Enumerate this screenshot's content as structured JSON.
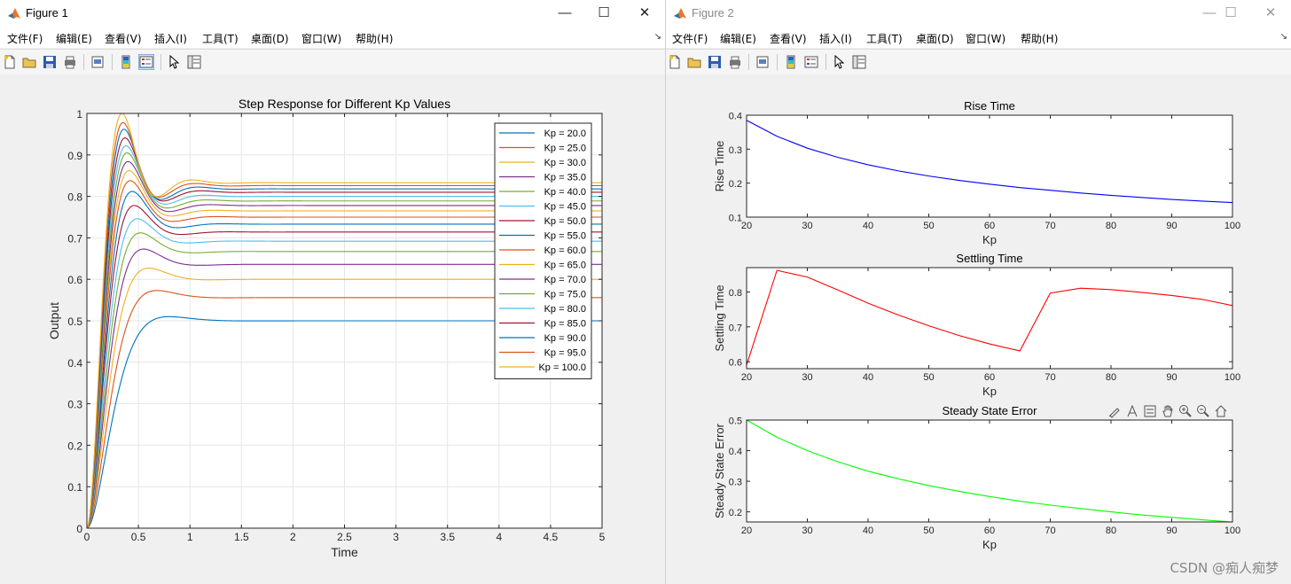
{
  "windows": [
    {
      "title": "Figure 1",
      "menus": [
        "文件(F)",
        "编辑(E)",
        "查看(V)",
        "插入(I)",
        "工具(T)",
        "桌面(D)",
        "窗口(W)",
        "帮助(H)"
      ]
    },
    {
      "title": "Figure 2",
      "menus": [
        "文件(F)",
        "编辑(E)",
        "查看(V)",
        "插入(I)",
        "工具(T)",
        "桌面(D)",
        "窗口(W)",
        "帮助(H)"
      ]
    }
  ],
  "window_controls": {
    "minimize": "—",
    "maximize": "☐",
    "close": "✕"
  },
  "toolbar_icons": [
    "new-figure-icon",
    "open-file-icon",
    "save-icon",
    "print-icon",
    "print-preview-icon",
    "colorbar-icon",
    "legend-icon",
    "pointer-icon",
    "property-editor-icon"
  ],
  "axes_toolbar_icons": [
    "brush-icon",
    "data-tips-icon",
    "export-icon",
    "pan-icon",
    "zoom-in-icon",
    "zoom-out-icon",
    "home-icon"
  ],
  "watermark": "CSDN @痴人痴梦",
  "chart_data": [
    {
      "type": "line",
      "title": "Step Response for Different Kp Values",
      "xlabel": "Time",
      "ylabel": "Output",
      "xlim": [
        0,
        5
      ],
      "ylim": [
        0,
        1
      ],
      "xticks": [
        "0",
        "0.5",
        "1",
        "1.5",
        "2",
        "2.5",
        "3",
        "3.5",
        "4",
        "4.5",
        "5"
      ],
      "yticks": [
        "0",
        "0.1",
        "0.2",
        "0.3",
        "0.4",
        "0.5",
        "0.6",
        "0.7",
        "0.8",
        "0.9",
        "1"
      ],
      "grid": true,
      "legend_position": "top-right",
      "series": [
        {
          "name": "Kp = 20.0",
          "color": "#0072BD",
          "final": 0.5,
          "peak": 0.51,
          "peak_time": 0.8
        },
        {
          "name": "Kp = 25.0",
          "color": "#D95319",
          "final": 0.556,
          "peak": 0.573,
          "peak_time": 0.68
        },
        {
          "name": "Kp = 30.0",
          "color": "#EDB120",
          "final": 0.6,
          "peak": 0.627,
          "peak_time": 0.6
        },
        {
          "name": "Kp = 35.0",
          "color": "#7E2F8E",
          "final": 0.636,
          "peak": 0.673,
          "peak_time": 0.55
        },
        {
          "name": "Kp = 40.0",
          "color": "#77AC30",
          "final": 0.667,
          "peak": 0.712,
          "peak_time": 0.52
        },
        {
          "name": "Kp = 45.0",
          "color": "#4DBEEE",
          "final": 0.692,
          "peak": 0.746,
          "peak_time": 0.49
        },
        {
          "name": "Kp = 50.0",
          "color": "#A2142F",
          "final": 0.714,
          "peak": 0.778,
          "peak_time": 0.46
        },
        {
          "name": "Kp = 55.0",
          "color": "#0072BD",
          "final": 0.733,
          "peak": 0.812,
          "peak_time": 0.44
        },
        {
          "name": "Kp = 60.0",
          "color": "#D95319",
          "final": 0.75,
          "peak": 0.838,
          "peak_time": 0.42
        },
        {
          "name": "Kp = 65.0",
          "color": "#EDB120",
          "final": 0.765,
          "peak": 0.862,
          "peak_time": 0.41
        },
        {
          "name": "Kp = 70.0",
          "color": "#7E2F8E",
          "final": 0.778,
          "peak": 0.884,
          "peak_time": 0.4
        },
        {
          "name": "Kp = 75.0",
          "color": "#77AC30",
          "final": 0.789,
          "peak": 0.905,
          "peak_time": 0.39
        },
        {
          "name": "Kp = 80.0",
          "color": "#4DBEEE",
          "final": 0.8,
          "peak": 0.922,
          "peak_time": 0.38
        },
        {
          "name": "Kp = 85.0",
          "color": "#A2142F",
          "final": 0.81,
          "peak": 0.941,
          "peak_time": 0.37
        },
        {
          "name": "Kp = 90.0",
          "color": "#0072BD",
          "final": 0.818,
          "peak": 0.962,
          "peak_time": 0.36
        },
        {
          "name": "Kp = 95.0",
          "color": "#D95319",
          "final": 0.826,
          "peak": 0.978,
          "peak_time": 0.35
        },
        {
          "name": "Kp = 100.0",
          "color": "#EDB120",
          "final": 0.833,
          "peak": 1.0,
          "peak_time": 0.34
        }
      ]
    },
    {
      "type": "line",
      "title": "Rise Time",
      "xlabel": "Kp",
      "ylabel": "Rise Time",
      "xlim": [
        20,
        100
      ],
      "ylim": [
        0.1,
        0.4
      ],
      "xticks": [
        "20",
        "30",
        "40",
        "50",
        "60",
        "70",
        "80",
        "90",
        "100"
      ],
      "yticks": [
        "0.1",
        "0.2",
        "0.3",
        "0.4"
      ],
      "color": "#0000FF",
      "x": [
        20,
        25,
        30,
        35,
        40,
        45,
        50,
        55,
        60,
        65,
        70,
        75,
        80,
        85,
        90,
        95,
        100
      ],
      "y": [
        0.385,
        0.338,
        0.303,
        0.276,
        0.254,
        0.236,
        0.221,
        0.208,
        0.197,
        0.187,
        0.179,
        0.171,
        0.164,
        0.158,
        0.152,
        0.147,
        0.143
      ]
    },
    {
      "type": "line",
      "title": "Settling Time",
      "xlabel": "Kp",
      "ylabel": "Settling Time",
      "xlim": [
        20,
        100
      ],
      "ylim": [
        0.58,
        0.87
      ],
      "xticks": [
        "20",
        "30",
        "40",
        "50",
        "60",
        "70",
        "80",
        "90",
        "100"
      ],
      "yticks": [
        "0.6",
        "0.7",
        "0.8"
      ],
      "color": "#FF0000",
      "x": [
        20,
        25,
        30,
        35,
        40,
        45,
        50,
        55,
        60,
        65,
        70,
        75,
        80,
        85,
        90,
        95,
        100
      ],
      "y": [
        0.59,
        0.862,
        0.843,
        0.806,
        0.768,
        0.734,
        0.703,
        0.675,
        0.651,
        0.631,
        0.797,
        0.811,
        0.807,
        0.799,
        0.79,
        0.779,
        0.761
      ]
    },
    {
      "type": "line",
      "title": "Steady State Error",
      "xlabel": "Kp",
      "ylabel": "Steady State Error",
      "xlim": [
        20,
        100
      ],
      "ylim": [
        0.167,
        0.5
      ],
      "xticks": [
        "20",
        "30",
        "40",
        "50",
        "60",
        "70",
        "80",
        "90",
        "100"
      ],
      "yticks": [
        "0.2",
        "0.3",
        "0.4",
        "0.5"
      ],
      "color": "#00FF00",
      "x": [
        20,
        25,
        30,
        35,
        40,
        45,
        50,
        55,
        60,
        65,
        70,
        75,
        80,
        85,
        90,
        95,
        100
      ],
      "y": [
        0.5,
        0.444,
        0.4,
        0.364,
        0.333,
        0.308,
        0.286,
        0.267,
        0.25,
        0.235,
        0.222,
        0.211,
        0.2,
        0.19,
        0.182,
        0.174,
        0.167
      ]
    }
  ]
}
